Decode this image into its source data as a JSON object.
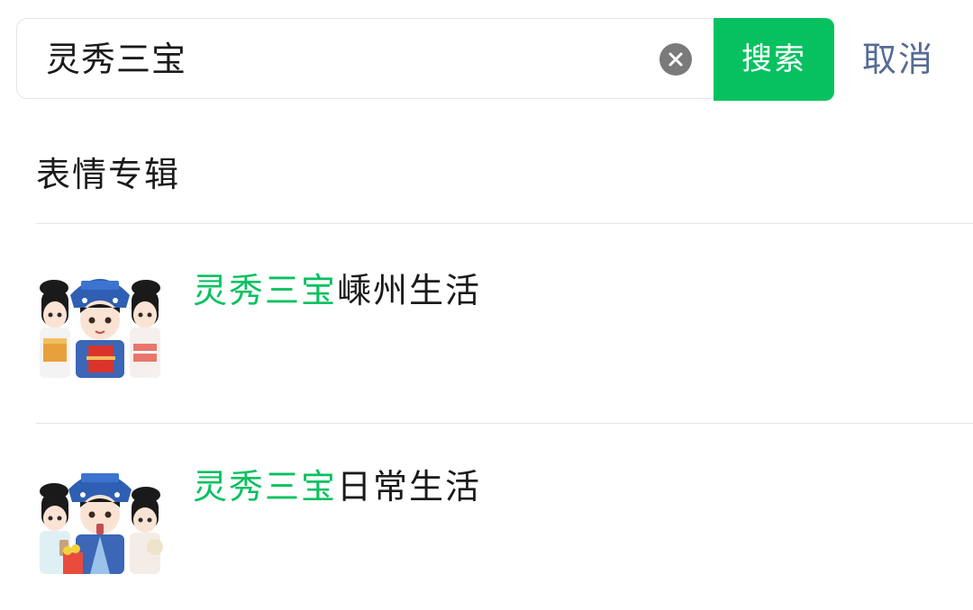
{
  "search": {
    "query": "灵秀三宝",
    "search_label": "搜索",
    "cancel_label": "取消"
  },
  "section": {
    "title": "表情专辑"
  },
  "results": [
    {
      "highlight": "灵秀三宝",
      "rest": "嵊州生活"
    },
    {
      "highlight": "灵秀三宝",
      "rest": "日常生活"
    }
  ],
  "colors": {
    "accent": "#07c160",
    "link": "#576b95",
    "clear_icon": "#7a7a7a"
  }
}
